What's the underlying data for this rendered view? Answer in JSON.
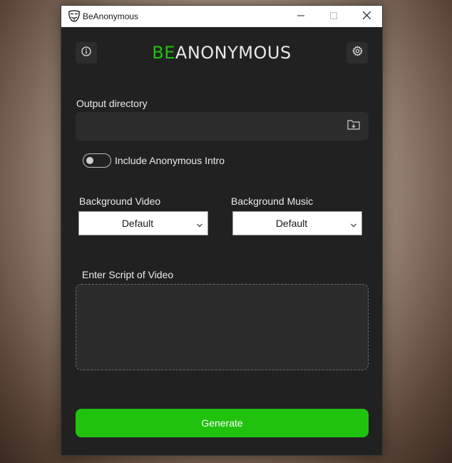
{
  "window": {
    "title": "BeAnonymous"
  },
  "header": {
    "logo_prefix": "BE",
    "logo_rest": "ANONYMOUS",
    "info_icon": "info-icon",
    "settings_icon": "gear-icon"
  },
  "output": {
    "label": "Output directory",
    "value": "",
    "placeholder": "",
    "browse_icon": "folder-download-icon"
  },
  "intro_toggle": {
    "label": "Include Anonymous Intro",
    "checked": false
  },
  "background_video": {
    "label": "Background Video",
    "selected": "Default"
  },
  "background_music": {
    "label": "Background Music",
    "selected": "Default"
  },
  "script": {
    "label": "Enter Script of Video",
    "value": ""
  },
  "actions": {
    "generate_label": "Generate"
  },
  "colors": {
    "accent": "#20c20e",
    "window_bg": "#212121",
    "field_bg": "#2c2c2c"
  }
}
